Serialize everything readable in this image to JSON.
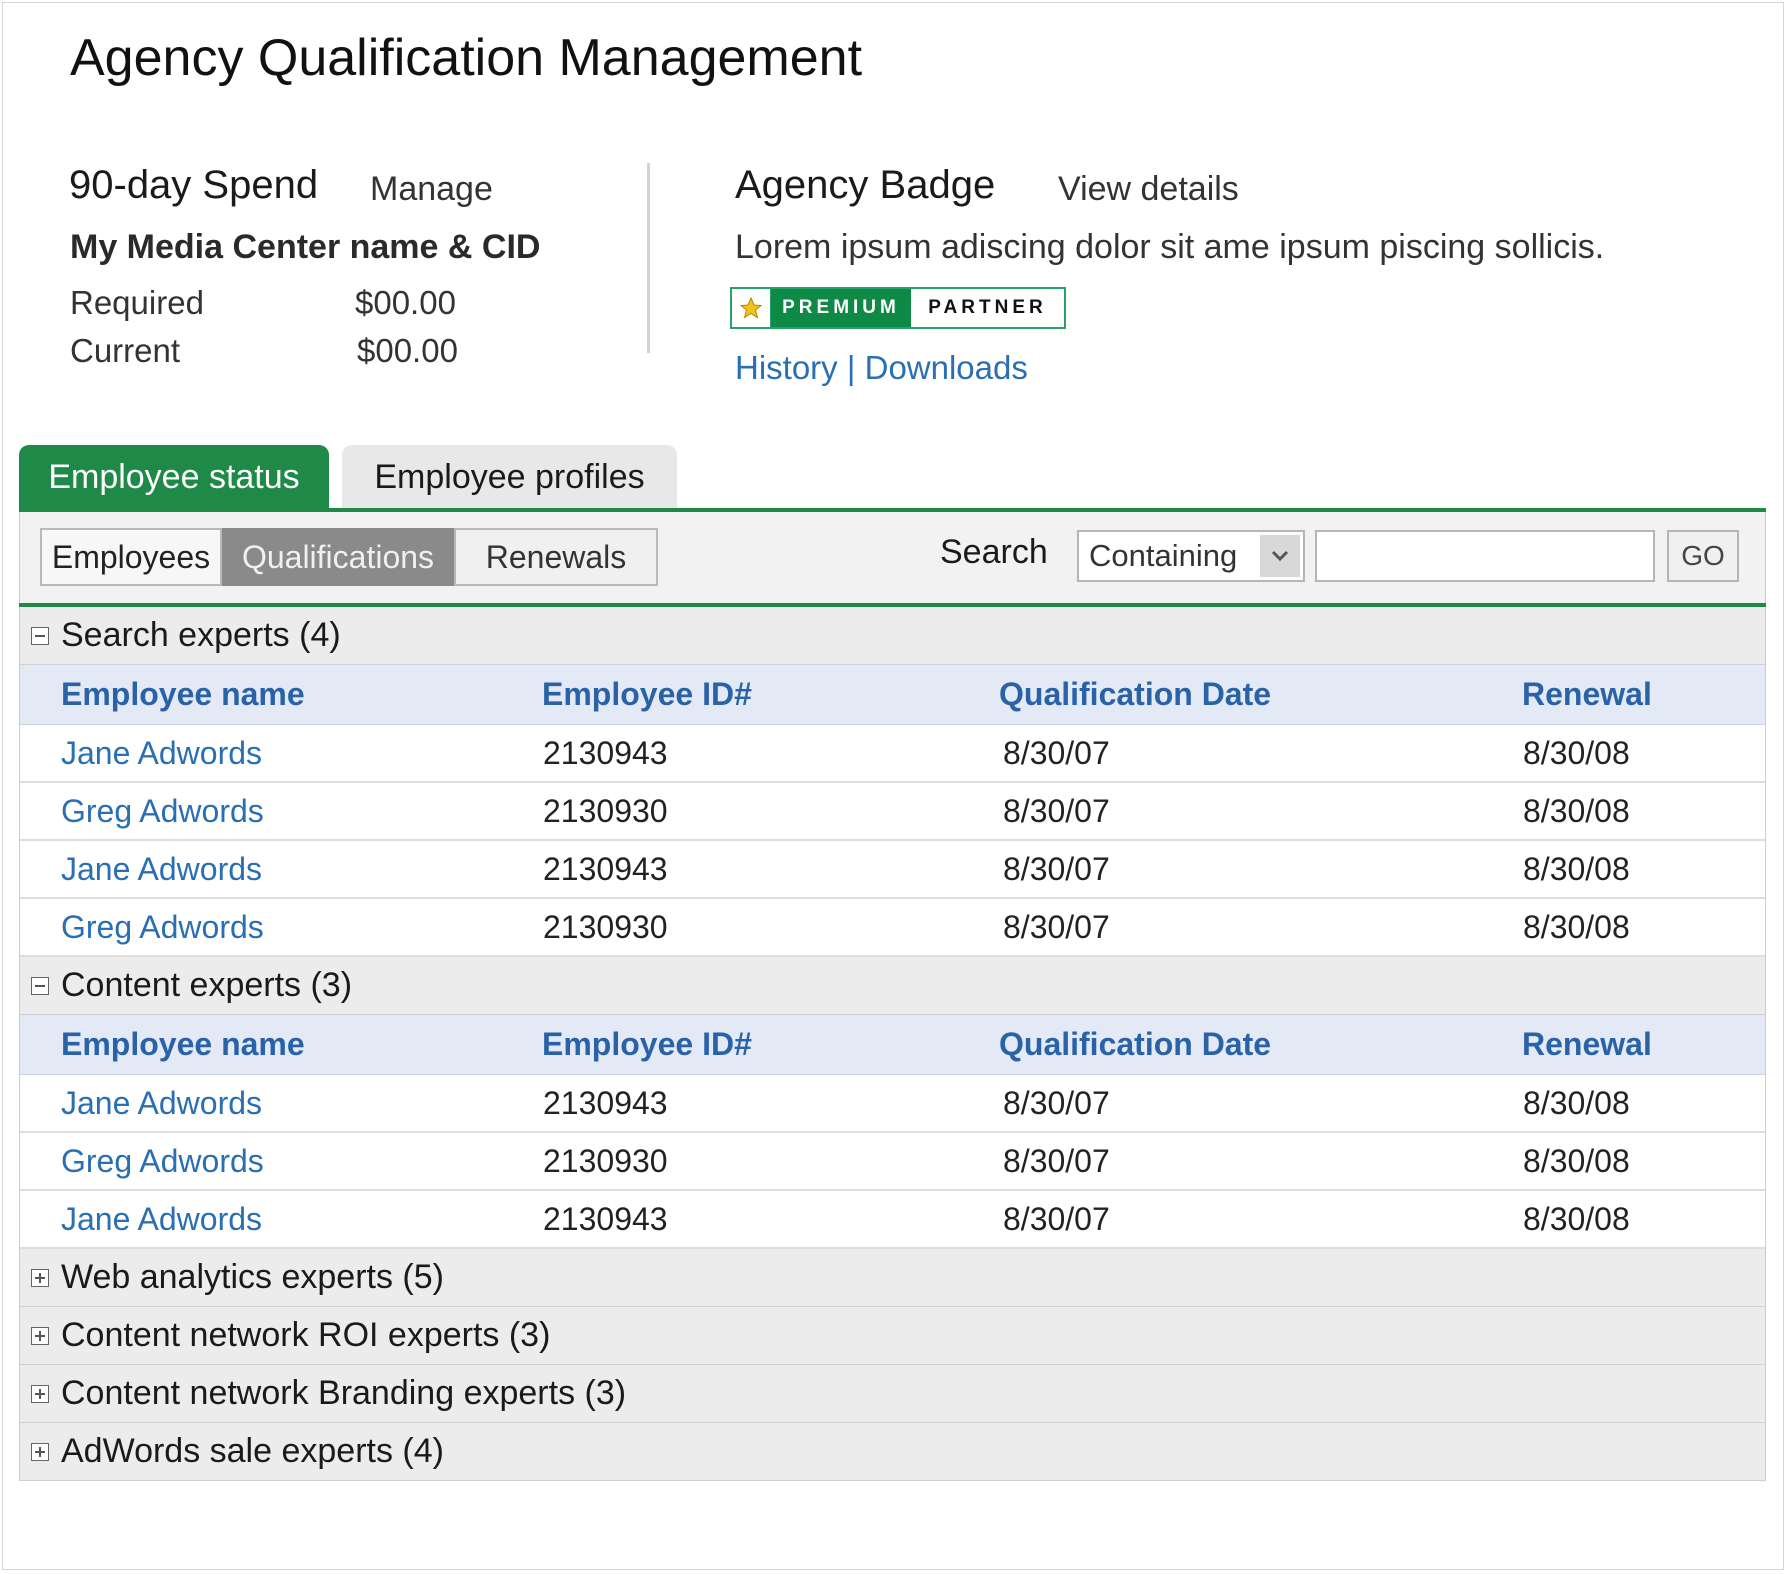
{
  "page": {
    "title": "Agency Qualification Management"
  },
  "spend": {
    "heading": "90-day Spend",
    "manage_link": "Manage",
    "center_name": "My Media Center name & CID",
    "required_label": "Required",
    "required_value": "$00.00",
    "current_label": "Current",
    "current_value": "$00.00"
  },
  "badge": {
    "heading": "Agency Badge",
    "view_details_link": "View details",
    "description": "Lorem ipsum adiscing dolor sit ame ipsum piscing sollicis.",
    "premium_text": "PREMIUM",
    "partner_text": "PARTNER",
    "history_link": "History",
    "separator": "|",
    "downloads_link": "Downloads"
  },
  "tabs": [
    {
      "label": "Employee status",
      "active": true
    },
    {
      "label": "Employee profiles",
      "active": false
    }
  ],
  "subtabs": [
    {
      "label": "Employees",
      "active": false
    },
    {
      "label": "Qualifications",
      "active": true
    },
    {
      "label": "Renewals",
      "active": false
    }
  ],
  "search": {
    "label": "Search",
    "mode_selected": "Containing",
    "query": "",
    "go_label": "GO"
  },
  "columns": [
    "Employee name",
    "Employee ID#",
    "Qualification Date",
    "Renewal"
  ],
  "groups": [
    {
      "title": "Search experts (4)",
      "expanded": true,
      "rows": [
        [
          "Jane Adwords",
          "2130943",
          "8/30/07",
          "8/30/08"
        ],
        [
          "Greg Adwords",
          "2130930",
          "8/30/07",
          "8/30/08"
        ],
        [
          "Jane Adwords",
          "2130943",
          "8/30/07",
          "8/30/08"
        ],
        [
          "Greg Adwords",
          "2130930",
          "8/30/07",
          "8/30/08"
        ]
      ]
    },
    {
      "title": "Content experts (3)",
      "expanded": true,
      "rows": [
        [
          "Jane Adwords",
          "2130943",
          "8/30/07",
          "8/30/08"
        ],
        [
          "Greg Adwords",
          "2130930",
          "8/30/07",
          "8/30/08"
        ],
        [
          "Jane Adwords",
          "2130943",
          "8/30/07",
          "8/30/08"
        ]
      ]
    },
    {
      "title": "Web analytics experts (5)",
      "expanded": false,
      "rows": []
    },
    {
      "title": "Content network ROI experts (3)",
      "expanded": false,
      "rows": []
    },
    {
      "title": "Content network Branding experts (3)",
      "expanded": false,
      "rows": []
    },
    {
      "title": "AdWords sale experts (4)",
      "expanded": false,
      "rows": []
    }
  ],
  "colors": {
    "accent_green": "#1f8a47",
    "link_blue": "#2a6fb4",
    "column_header_bg": "#e3eaf6"
  }
}
